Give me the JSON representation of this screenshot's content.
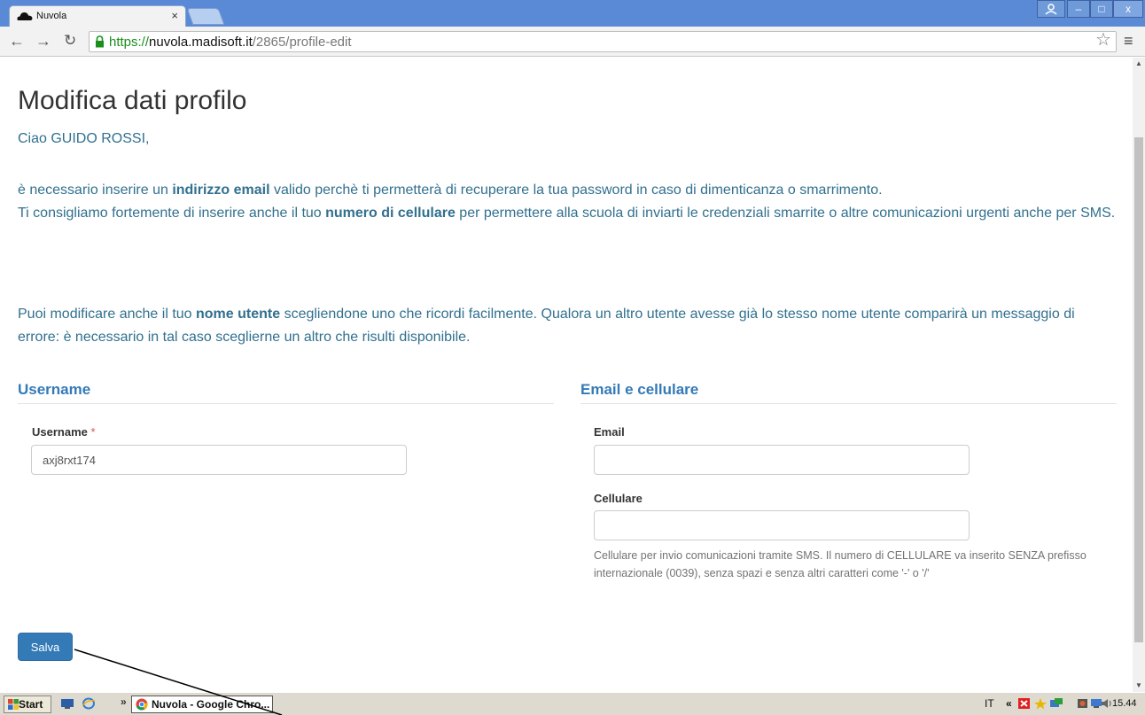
{
  "browser": {
    "tab_title": "Nuvola",
    "tab_close": "×",
    "url_scheme": "https://",
    "url_host": "nuvola.madisoft.it",
    "url_path": "/2865/profile-edit",
    "window_controls": [
      "–",
      "□",
      "x"
    ]
  },
  "page": {
    "title": "Modifica dati profilo",
    "greeting": "Ciao GUIDO ROSSI,",
    "intro_email_1": "è necessario inserire un ",
    "intro_email_bold": "indirizzo email",
    "intro_email_2": " valido perchè ti permetterà di recuperare la tua password in caso di dimenticanza o smarrimento.",
    "intro_phone_1": "Ti consigliamo fortemente di inserire anche il tuo ",
    "intro_phone_bold": "numero di cellulare",
    "intro_phone_2": " per permettere alla scuola di inviarti le credenziali smarrite o altre comunicazioni urgenti anche per SMS.",
    "intro_user_1": "Puoi modificare anche il tuo ",
    "intro_user_bold": "nome utente",
    "intro_user_2": " scegliendone uno che ricordi facilmente. Qualora un altro utente avesse già lo stesso nome utente comparirà un messaggio di errore: è necessario in tal caso sceglierne un altro che risulti disponibile."
  },
  "username_section": {
    "title": "Username",
    "label": "Username",
    "required_mark": "*",
    "value": "axj8rxt174"
  },
  "contact_section": {
    "title": "Email e cellulare",
    "email_label": "Email",
    "email_value": "",
    "phone_label": "Cellulare",
    "phone_value": "",
    "phone_help": "Cellulare per invio comunicazioni tramite SMS. Il numero di CELLULARE va inserito SENZA prefisso internazionale (0039), senza spazi e senza altri caratteri come '-' o '/'"
  },
  "actions": {
    "save_label": "Salva"
  },
  "taskbar": {
    "start_label": "Start",
    "overflow": "»",
    "task_label": "Nuvola - Google Chro...",
    "language": "IT",
    "tray_chevron": "«",
    "clock": "15.44"
  },
  "colors": {
    "info_text": "#31708f",
    "primary": "#337ab7",
    "titlebar": "#5a8ad6"
  }
}
